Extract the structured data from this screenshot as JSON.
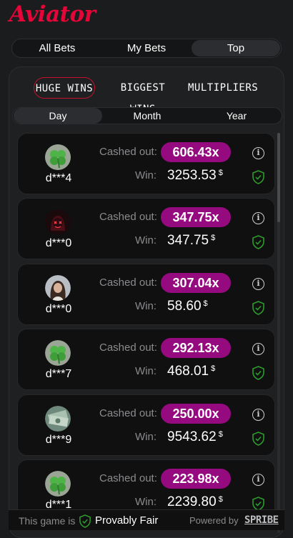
{
  "app": {
    "logo_text": "Aviator",
    "brand_color": "#e50539",
    "multiplier_color": "#960a7f",
    "shield_color": "#2e9b2e"
  },
  "main_tabs": [
    {
      "label": "All Bets",
      "active": false
    },
    {
      "label": "My Bets",
      "active": false
    },
    {
      "label": "Top",
      "active": true
    }
  ],
  "sub_tabs": [
    {
      "label": "HUGE WINS",
      "active": true
    },
    {
      "label": "BIGGEST WINS",
      "active": false
    },
    {
      "label": "MULTIPLIERS",
      "active": false
    }
  ],
  "period_tabs": [
    {
      "label": "Day",
      "active": true
    },
    {
      "label": "Month",
      "active": false
    },
    {
      "label": "Year",
      "active": false
    }
  ],
  "labels": {
    "cashed_out": "Cashed out:",
    "win": "Win:",
    "currency": "$"
  },
  "bets": [
    {
      "user": "d***4",
      "avatar": "clover-avatar",
      "multiplier": "606.43x",
      "win": "3253.53"
    },
    {
      "user": "d***0",
      "avatar": "masked-figure-avatar",
      "multiplier": "347.75x",
      "win": "347.75"
    },
    {
      "user": "d***0",
      "avatar": "woman-photo-avatar",
      "multiplier": "307.04x",
      "win": "58.60"
    },
    {
      "user": "d***7",
      "avatar": "clover-avatar",
      "multiplier": "292.13x",
      "win": "468.01"
    },
    {
      "user": "d***9",
      "avatar": "money-avatar",
      "multiplier": "250.00x",
      "win": "9543.62"
    },
    {
      "user": "d***1",
      "avatar": "clover-avatar",
      "multiplier": "223.98x",
      "win": "2239.80"
    }
  ],
  "footer": {
    "game_is": "This game is",
    "provably_fair": "Provably Fair",
    "powered_by": "Powered by",
    "provider": "SPRIBE"
  }
}
